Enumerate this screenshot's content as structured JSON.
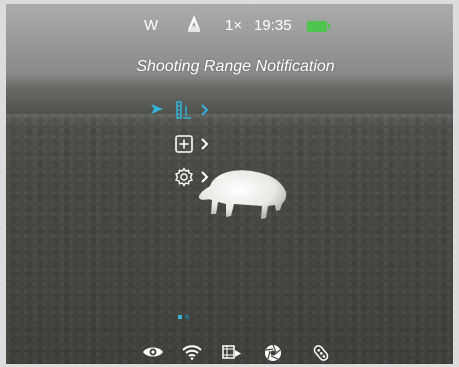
{
  "status_bar": {
    "mode": "W",
    "calibration_icon": "calibration-icon",
    "zoom": "1×",
    "time": "19:35",
    "battery_icon": "battery-icon",
    "battery_color": "#4ec54e"
  },
  "notification": "Shooting Range Notification",
  "menu": {
    "accent": "#35b2d8",
    "items": [
      {
        "icon": "rangefinder-icon",
        "selected": true
      },
      {
        "icon": "plus-square-icon",
        "selected": false
      },
      {
        "icon": "gear-icon",
        "selected": false
      }
    ]
  },
  "page_indicator": {
    "count": 2,
    "active": 1
  },
  "bottom_icons": [
    "eye-icon",
    "wifi-icon",
    "video-record-icon",
    "aperture-icon",
    "remote-icon"
  ]
}
